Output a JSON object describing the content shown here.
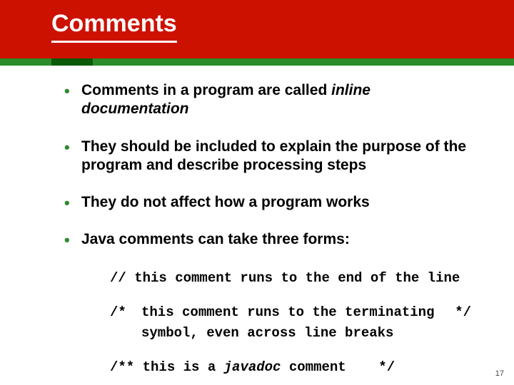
{
  "header": {
    "title": "Comments"
  },
  "bullets": {
    "b1_pre": "Comments in a program are called ",
    "b1_em": "inline documentation",
    "b2": "They should be included to explain the purpose of the program and describe processing steps",
    "b3": "They do not affect how a program works",
    "b4": "Java comments can take three forms:"
  },
  "code": {
    "line1": "// this comment runs to the end of the line",
    "block_open": "/*",
    "block_l1": "this comment runs to the terminating",
    "block_l2": "symbol, even across line breaks",
    "block_close": "*/",
    "jd_open": "/** ",
    "jd_pre": "this is a ",
    "jd_em": "javadoc",
    "jd_post": " comment",
    "jd_close": "*/"
  },
  "page_number": "17"
}
